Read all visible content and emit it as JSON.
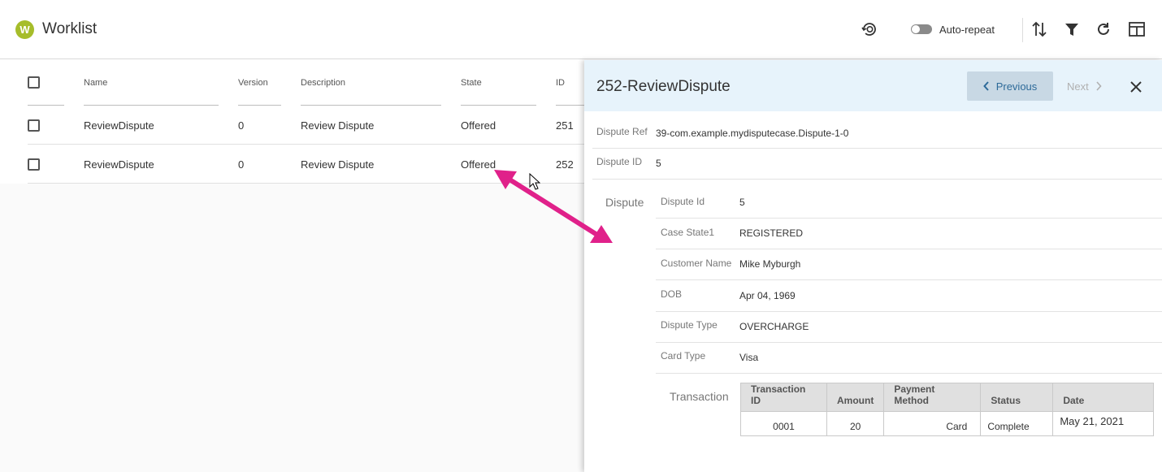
{
  "header": {
    "logo_letter": "W",
    "title": "Worklist",
    "auto_repeat_label": "Auto-repeat"
  },
  "table": {
    "columns": [
      "Name",
      "Version",
      "Description",
      "State",
      "ID"
    ],
    "rows": [
      {
        "name": "ReviewDispute",
        "version": "0",
        "description": "Review Dispute",
        "state": "Offered",
        "id": "251"
      },
      {
        "name": "ReviewDispute",
        "version": "0",
        "description": "Review Dispute",
        "state": "Offered",
        "id": "252"
      }
    ]
  },
  "panel": {
    "title": "252-ReviewDispute",
    "previous_label": "Previous",
    "next_label": "Next",
    "dispute_ref_label": "Dispute Ref",
    "dispute_ref_value": "39-com.example.mydisputecase.Dispute-1-0",
    "dispute_id_label": "Dispute ID",
    "dispute_id_value": "5",
    "dispute_section_label": "Dispute",
    "fields": [
      {
        "label": "Dispute Id",
        "value": "5"
      },
      {
        "label": "Case State1",
        "value": "REGISTERED"
      },
      {
        "label": "Customer Name",
        "value": "Mike Myburgh"
      },
      {
        "label": "DOB",
        "value": "Apr 04, 1969"
      },
      {
        "label": "Dispute Type",
        "value": "OVERCHARGE"
      },
      {
        "label": "Card Type",
        "value": "Visa"
      }
    ],
    "transaction_label": "Transaction",
    "transaction": {
      "columns": [
        "Transaction ID",
        "Amount",
        "Payment Method",
        "Status",
        "Date"
      ],
      "row": {
        "id": "0001",
        "amount": "20",
        "method": "Card",
        "status": "Complete",
        "date": "May 21, 2021"
      }
    }
  },
  "colors": {
    "logo": "#a6bd2a",
    "panel_header": "#e7f3fb",
    "previous_button": "#c8d8e4",
    "arrow": "#e0218a"
  },
  "icons": [
    "history-icon",
    "sort-icon",
    "filter-icon",
    "refresh-icon",
    "columns-icon",
    "close-icon",
    "chevron-left-icon",
    "chevron-right-icon"
  ]
}
